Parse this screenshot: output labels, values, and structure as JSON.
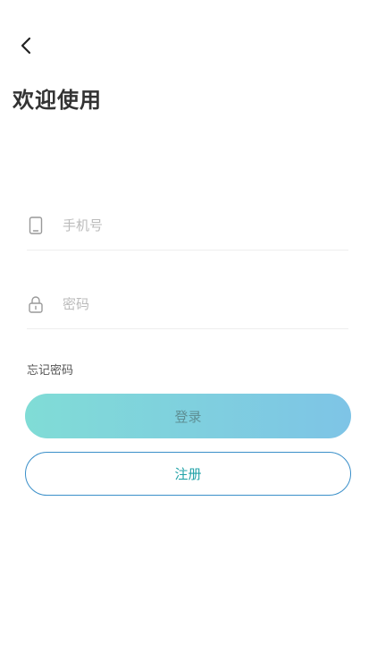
{
  "header": {
    "back_icon": "chevron-left-icon",
    "title": "欢迎使用"
  },
  "form": {
    "phone": {
      "icon": "phone-icon",
      "placeholder": "手机号",
      "value": ""
    },
    "password": {
      "icon": "lock-icon",
      "placeholder": "密码",
      "value": ""
    },
    "forgot_label": "忘记密码",
    "login_label": "登录",
    "register_label": "注册"
  },
  "colors": {
    "login_gradient_start": "#80dcd6",
    "login_gradient_end": "#7ec4e6",
    "register_border": "#3a8fc9",
    "register_text": "#22a3a8"
  }
}
